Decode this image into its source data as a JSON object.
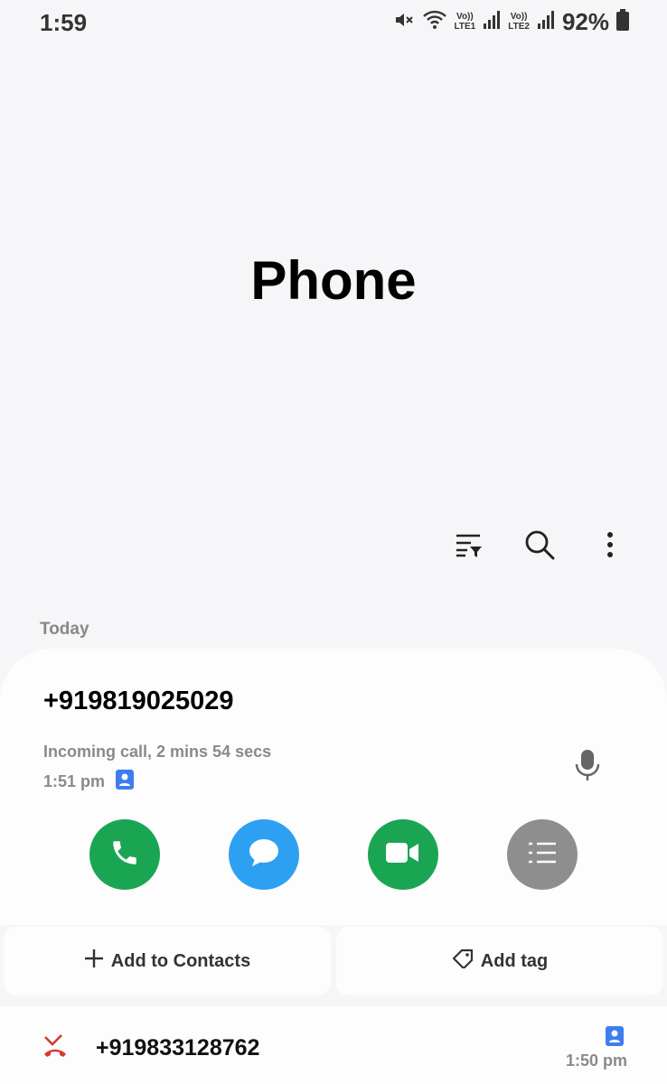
{
  "status_bar": {
    "time": "1:59",
    "sim1_top": "Vo))",
    "sim1_bottom": "LTE1",
    "sim2_top": "Vo))",
    "sim2_bottom": "LTE2",
    "battery": "92%"
  },
  "header": {
    "title": "Phone"
  },
  "sections": {
    "today": "Today"
  },
  "expanded_call": {
    "number": "+919819025029",
    "detail": "Incoming call, 2 mins 54 secs",
    "time": "1:51 pm"
  },
  "actions": {
    "add_contact": "Add to Contacts",
    "add_tag": "Add tag"
  },
  "call_log": [
    {
      "number": "+919833128762",
      "time": "1:50 pm"
    }
  ],
  "colors": {
    "call_green": "#1aa552",
    "message_blue": "#2ea0f2",
    "video_green": "#1aa552",
    "details_gray": "#8e8e8e",
    "contact_blue": "#3d7df0",
    "missed_red": "#d63b2f"
  }
}
